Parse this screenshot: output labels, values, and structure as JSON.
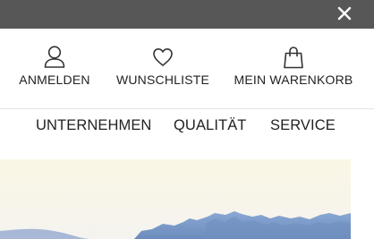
{
  "topbar": {
    "close_icon": "close-icon"
  },
  "header": {
    "actions": [
      {
        "label": "ANMELDEN",
        "icon": "user-icon"
      },
      {
        "label": "WUNSCHLISTE",
        "icon": "heart-icon"
      },
      {
        "label": "MEIN WARENKORB",
        "icon": "shopping-bag-icon"
      }
    ]
  },
  "nav": {
    "items": [
      {
        "label": "UNTERNEHMEN"
      },
      {
        "label": "QUALITÄT"
      },
      {
        "label": "SERVICE"
      }
    ]
  },
  "hero": {
    "image": "mountain-landscape-photo"
  },
  "colors": {
    "topbar": "#575757",
    "text": "#222222",
    "divider": "#e3e3e3",
    "sky": "#fbf6e6",
    "mountain": "#7a9bc8"
  }
}
